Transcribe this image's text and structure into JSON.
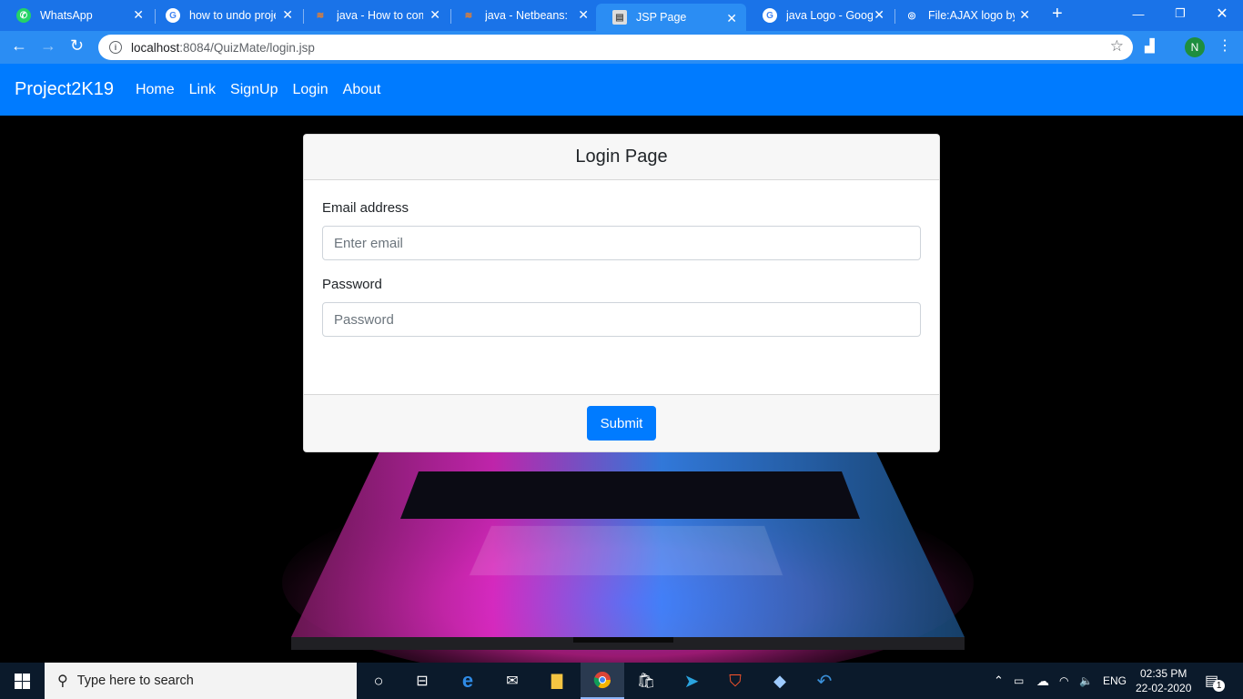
{
  "browser": {
    "tabs": [
      {
        "title": "WhatsApp",
        "icon": "whatsapp-icon"
      },
      {
        "title": "how to undo proje",
        "icon": "google-icon"
      },
      {
        "title": "java - How to com",
        "icon": "stackoverflow-icon"
      },
      {
        "title": "java - Netbeans: h",
        "icon": "stackoverflow-icon"
      },
      {
        "title": "JSP Page",
        "icon": "page-icon"
      },
      {
        "title": "java Logo - Googl",
        "icon": "google-icon"
      },
      {
        "title": "File:AJAX logo by",
        "icon": "wikimedia-icon"
      }
    ],
    "url_host": "localhost",
    "url_rest": ":8084/QuizMate/login.jsp",
    "profile_initial": "N"
  },
  "site": {
    "brand": "Project2K19",
    "nav": [
      "Home",
      "Link",
      "SignUp",
      "Login",
      "About"
    ]
  },
  "login": {
    "header": "Login Page",
    "email_label": "Email address",
    "email_placeholder": "Enter email",
    "password_label": "Password",
    "password_placeholder": "Password",
    "submit": "Submit"
  },
  "taskbar": {
    "search_placeholder": "Type here to search",
    "lang": "ENG",
    "time": "02:35 PM",
    "date": "22-02-2020",
    "notification_count": "1"
  },
  "colors": {
    "primary": "#007bff",
    "chrome": "#1a73e8"
  }
}
